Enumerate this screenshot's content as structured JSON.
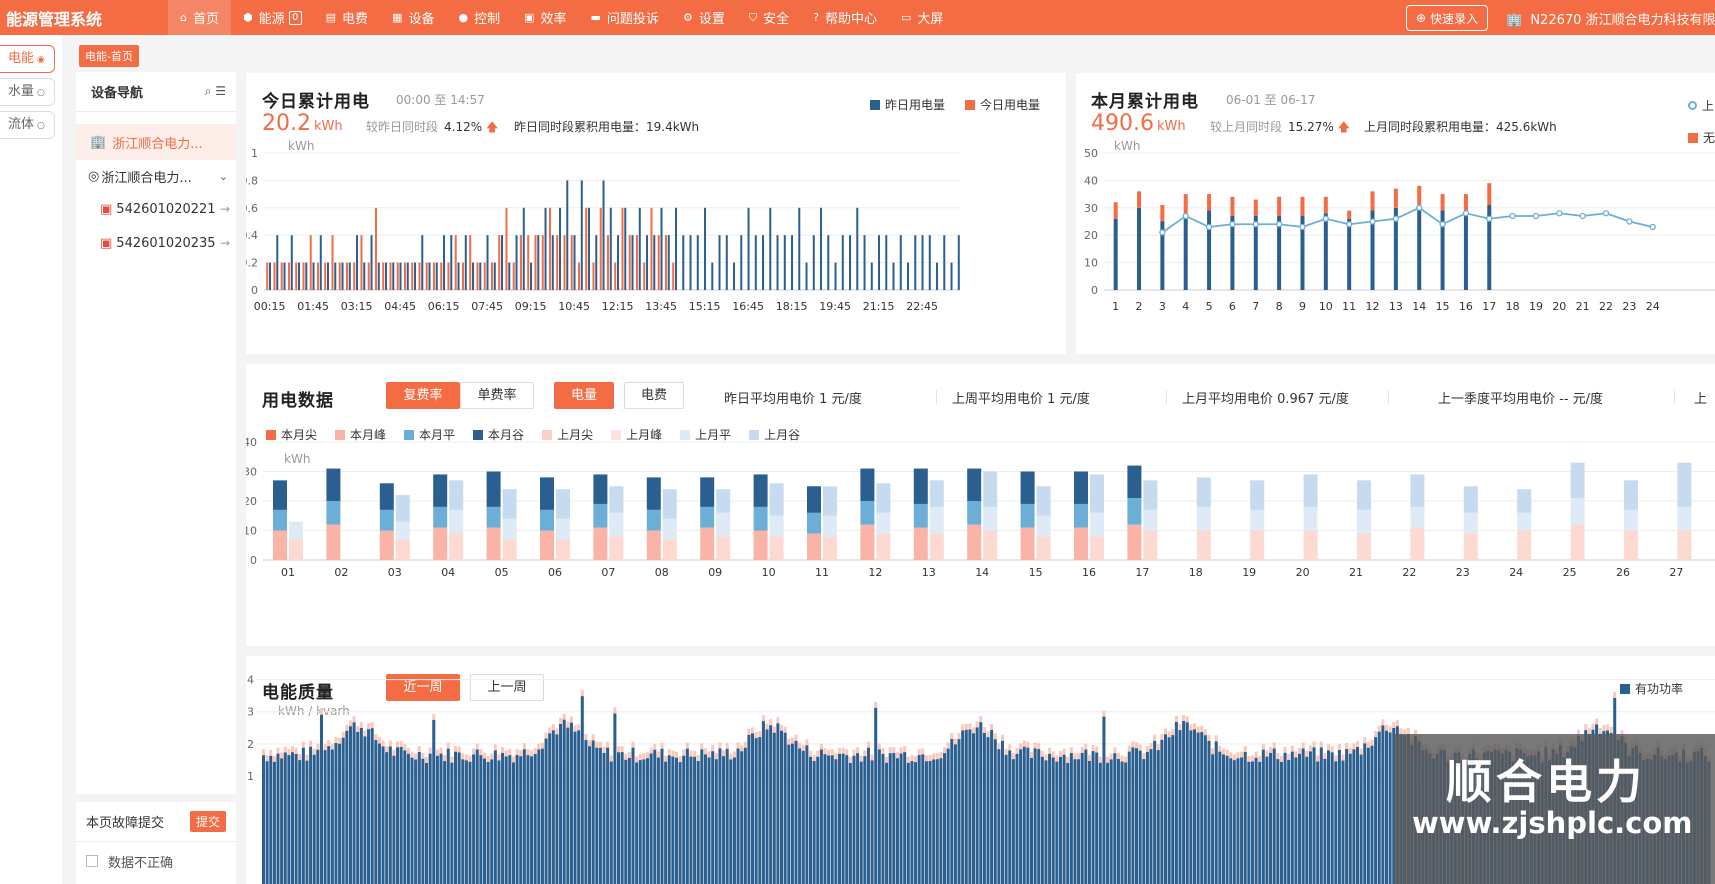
{
  "app": {
    "title": "能源管理系统"
  },
  "nav": [
    {
      "label": "首页",
      "icon": "home-icon",
      "glyph": "⌂",
      "active": true
    },
    {
      "label": "能源",
      "icon": "energy-icon",
      "glyph": "⬢",
      "badge": "0"
    },
    {
      "label": "电费",
      "icon": "bill-icon",
      "glyph": "▤"
    },
    {
      "label": "设备",
      "icon": "device-icon",
      "glyph": "▦"
    },
    {
      "label": "控制",
      "icon": "control-icon",
      "glyph": "●"
    },
    {
      "label": "效率",
      "icon": "efficiency-icon",
      "glyph": "▣"
    },
    {
      "label": "问题投诉",
      "icon": "complaint-icon",
      "glyph": "▬"
    },
    {
      "label": "设置",
      "icon": "settings-icon",
      "glyph": "⚙"
    },
    {
      "label": "安全",
      "icon": "shield-icon",
      "glyph": "⛉"
    },
    {
      "label": "帮助中心",
      "icon": "help-icon",
      "glyph": "?"
    },
    {
      "label": "大屏",
      "icon": "screen-icon",
      "glyph": "▭"
    }
  ],
  "header": {
    "quick_entry": "快速录入",
    "company": "N22670 浙江顺合电力科技有限公司"
  },
  "rail": [
    {
      "label": "电能",
      "dot": "◉",
      "active": true
    },
    {
      "label": "水量",
      "dot": "○"
    },
    {
      "label": "流体",
      "dot": "○"
    }
  ],
  "breadcrumb": "电能-首页",
  "tree": {
    "title": "设备导航",
    "root": "浙江顺合电力...",
    "node": "浙江顺合电力...",
    "leaves": [
      "542601020221",
      "542601020235"
    ]
  },
  "fault": {
    "label": "本页故障提交",
    "submit": "提交",
    "checkbox_label": "数据不正确"
  },
  "today": {
    "title": "今日累计用电",
    "range": "00:00 至 14:57",
    "value": "20.2",
    "unit": "kWh",
    "cmp_label": "较昨日同时段",
    "cmp_value": "4.12%",
    "cmp_arrow": "🡅",
    "prev_label": "昨日同时段累积用电量：19.4kWh",
    "axis_unit": "kWh",
    "legend": [
      "昨日用电量",
      "今日用电量"
    ]
  },
  "month": {
    "title": "本月累计用电",
    "range": "06-01 至 06-17",
    "value": "490.6",
    "unit": "kWh",
    "cmp_label": "较上月同时段",
    "cmp_value": "15.27%",
    "cmp_arrow": "🡅",
    "prev_label": "上月同时段累积用电量：425.6kWh",
    "axis_unit": "kWh",
    "legend": [
      "上",
      "无"
    ]
  },
  "usage": {
    "title": "用电数据",
    "tabs_rate": [
      "复费率",
      "单费率"
    ],
    "tabs_type": [
      "电量",
      "电费"
    ],
    "prices": [
      "昨日平均用电价 1 元/度",
      "上周平均用电价 1 元/度",
      "上月平均用电价 0.967 元/度",
      "上一季度平均用电价 -- 元/度",
      "上"
    ],
    "legend": [
      "本月尖",
      "本月峰",
      "本月平",
      "本月谷",
      "上月尖",
      "上月峰",
      "上月平",
      "上月谷"
    ],
    "axis_unit": "kWh"
  },
  "quality": {
    "title": "电能质量",
    "tabs": [
      "近一周",
      "上一周"
    ],
    "axis_unit": "kWh / kvarh",
    "legend": [
      "有功功率"
    ]
  },
  "watermark": {
    "text": "顺合电力",
    "url": "www.zjshplc.com"
  },
  "colors": {
    "accent": "#f36c44",
    "dark_blue": "#2b5f8f",
    "mid_blue": "#6baed6",
    "light_blue": "#c6dbef",
    "pale_blue": "#deebf7",
    "pink": "#f9b3a7",
    "pale_pink": "#fcd9d1"
  },
  "chart_data": [
    {
      "type": "bar",
      "title": "今日累计用电",
      "ylabel": "kWh",
      "ylim": [
        0,
        1
      ],
      "yticks": [
        0,
        0.2,
        0.4,
        0.6,
        0.8,
        1
      ],
      "x_tick_labels": [
        "00:15",
        "01:45",
        "03:15",
        "04:45",
        "06:15",
        "07:45",
        "09:15",
        "10:45",
        "12:15",
        "13:45",
        "15:15",
        "16:45",
        "18:15",
        "19:45",
        "21:15",
        "22:45"
      ],
      "interval_minutes": 15,
      "series": [
        {
          "name": "昨日用电量",
          "values": [
            0.2,
            0.4,
            0.2,
            0.4,
            0.2,
            0.2,
            0.2,
            0.4,
            0.2,
            0.2,
            0.2,
            0.2,
            0.4,
            0.2,
            0.4,
            0.2,
            0.2,
            0.2,
            0.2,
            0.2,
            0.2,
            0.4,
            0.2,
            0.2,
            0.4,
            0.4,
            0.2,
            0.4,
            0.2,
            0.2,
            0.4,
            0.2,
            0.4,
            0.2,
            0.4,
            0.6,
            0.2,
            0.4,
            0.6,
            0.4,
            0.6,
            0.8,
            0.4,
            0.8,
            0.6,
            0.4,
            0.8,
            0.6,
            0.4,
            0.6,
            0.4,
            0.6,
            0.4,
            0.4,
            0.6,
            0.4,
            0.6,
            0.4,
            0.4,
            0.4,
            0.6,
            0.2,
            0.4,
            0.4,
            0.2,
            0.4,
            0.6,
            0.4,
            0.4,
            0.6,
            0.4,
            0.4,
            0.4,
            0.6,
            0.2,
            0.4,
            0.6,
            0.4,
            0.2,
            0.4,
            0.4,
            0.6,
            0.4,
            0.2,
            0.4,
            0.4,
            0.2,
            0.4,
            0.2,
            0.4,
            0.4,
            0.4,
            0.2,
            0.4,
            0.2,
            0.4
          ]
        },
        {
          "name": "今日用电量",
          "values": [
            0.2,
            0.2,
            0.2,
            0.2,
            0.2,
            0.2,
            0.4,
            0.2,
            0.2,
            0.4,
            0.2,
            0.2,
            0.2,
            0.4,
            0.2,
            0.6,
            0.2,
            0.2,
            0.2,
            0.2,
            0.2,
            0.2,
            0.2,
            0.2,
            0.2,
            0.2,
            0.4,
            0.2,
            0.4,
            0.2,
            0.2,
            0.2,
            0.4,
            0.6,
            0.2,
            0.4,
            0.4,
            0.4,
            0.4,
            0.6,
            0.4,
            0.4,
            0.4,
            0.2,
            0.6,
            0.2,
            0.6,
            0.4,
            0.2,
            0.6,
            0.4,
            0.4,
            0.2,
            0.6,
            0.4,
            0.4,
            0.2
          ]
        }
      ]
    },
    {
      "type": "bar",
      "title": "本月累计用电",
      "ylabel": "kWh",
      "ylim": [
        0,
        50
      ],
      "yticks": [
        0,
        10,
        20,
        30,
        40,
        50
      ],
      "x": [
        1,
        2,
        3,
        4,
        5,
        6,
        7,
        8,
        9,
        10,
        11,
        12,
        13,
        14,
        15,
        16,
        17,
        18,
        19,
        20,
        21,
        22,
        23,
        24
      ],
      "series": [
        {
          "name": "本月谷",
          "values": [
            26,
            30,
            25,
            26,
            29,
            27,
            27,
            27,
            27,
            28,
            26,
            29,
            30,
            31,
            29,
            29,
            31
          ]
        },
        {
          "name": "本月尖",
          "values": [
            6,
            6,
            6,
            9,
            6,
            7,
            6,
            7,
            7,
            6,
            3,
            7,
            7,
            7,
            6,
            6,
            8
          ]
        },
        {
          "name": "上",
          "type": "line",
          "values": [
            null,
            null,
            21,
            27,
            23,
            24,
            24,
            24,
            23,
            26,
            24,
            25,
            26,
            30,
            24,
            28,
            26,
            27,
            27,
            28,
            27,
            28,
            25,
            23
          ]
        }
      ]
    },
    {
      "type": "bar",
      "title": "用电数据",
      "ylabel": "kWh",
      "ylim": [
        0,
        40
      ],
      "yticks": [
        0,
        10,
        20,
        30,
        40
      ],
      "categories": [
        "01",
        "02",
        "03",
        "04",
        "05",
        "06",
        "07",
        "08",
        "09",
        "10",
        "11",
        "12",
        "13",
        "14",
        "15",
        "16",
        "17",
        "18",
        "19",
        "20",
        "21",
        "22",
        "23",
        "24",
        "25",
        "26",
        "27"
      ],
      "series": [
        {
          "name": "本月峰",
          "values": [
            10,
            12,
            10,
            11,
            11,
            10,
            11,
            10,
            11,
            10,
            9,
            12,
            11,
            12,
            11,
            11,
            12
          ]
        },
        {
          "name": "本月平",
          "values": [
            7,
            8,
            7,
            7,
            7,
            7,
            8,
            7,
            7,
            8,
            7,
            8,
            8,
            8,
            8,
            8,
            9
          ]
        },
        {
          "name": "本月谷",
          "values": [
            10,
            11,
            9,
            11,
            12,
            11,
            10,
            11,
            10,
            11,
            9,
            11,
            12,
            11,
            11,
            11,
            11
          ]
        },
        {
          "name": "上月峰",
          "values": [
            7,
            null,
            7,
            9,
            7,
            7,
            8,
            7,
            8,
            8,
            8,
            9,
            9,
            10,
            8,
            8,
            10,
            10,
            10,
            10,
            9,
            11,
            9,
            10,
            12,
            10,
            10
          ]
        },
        {
          "name": "上月平",
          "values": [
            6,
            null,
            6,
            8,
            7,
            7,
            8,
            7,
            8,
            7,
            7,
            7,
            9,
            8,
            7,
            8,
            7,
            8,
            7,
            8,
            8,
            7,
            7,
            6,
            9,
            7,
            8
          ]
        },
        {
          "name": "上月谷",
          "values": [
            null,
            null,
            9,
            10,
            10,
            10,
            9,
            10,
            8,
            11,
            10,
            10,
            9,
            12,
            10,
            13,
            10,
            10,
            10,
            11,
            10,
            11,
            9,
            8,
            12,
            10,
            15
          ]
        }
      ]
    },
    {
      "type": "bar",
      "title": "电能质量",
      "ylabel": "kWh / kvarh",
      "ylim": [
        0,
        5
      ],
      "yticks": [
        1,
        2,
        3,
        4,
        5
      ],
      "series": [
        {
          "name": "有功功率"
        }
      ]
    }
  ]
}
